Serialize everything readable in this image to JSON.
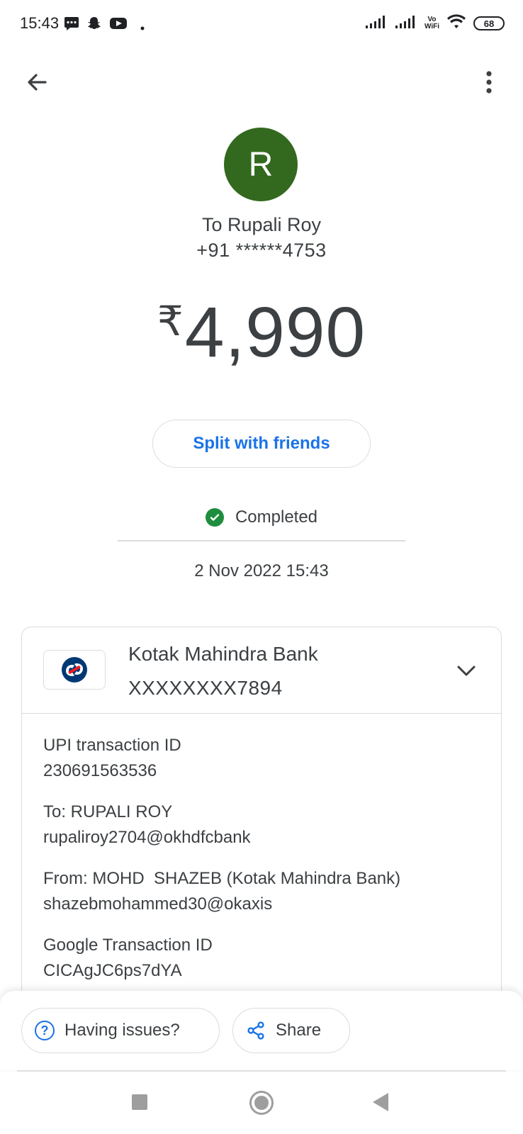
{
  "status_bar": {
    "time": "15:43",
    "battery": "68",
    "vowifi_top": "Vo",
    "vowifi_bottom": "WiFi",
    "left_icons": [
      "message-icon",
      "snapchat-icon",
      "youtube-icon",
      "dot-icon"
    ],
    "right_icons": [
      "signal-icon",
      "signal-icon",
      "vowifi-icon",
      "wifi-icon",
      "battery-icon"
    ]
  },
  "header": {
    "back_icon": "arrow-left-icon",
    "more_icon": "more-vert-icon"
  },
  "recipient": {
    "initial": "R",
    "avatar_color": "#33691e",
    "name_line": "To Rupali Roy",
    "phone": "+91 ******4753"
  },
  "payment": {
    "currency_symbol": "₹",
    "amount": "4,990"
  },
  "split_button": {
    "label": "Split with friends",
    "color": "#1a73e8"
  },
  "transaction_status": {
    "label": "Completed",
    "icon": "check-circle-icon",
    "color": "#1e8e3e"
  },
  "datetime": "2 Nov 2022 15:43",
  "bank_card": {
    "bank_name": "Kotak Mahindra Bank",
    "account_number": "XXXXXXXX7894",
    "logo_icon": "kotak-logo-icon",
    "expand_icon": "chevron-down-icon"
  },
  "details": {
    "upi_label": "UPI transaction ID",
    "upi_value": "230691563536",
    "to_label": "To: RUPALI ROY",
    "to_value": "rupaliroy2704@okhdfcbank",
    "from_label": "From: MOHD  SHAZEB (Kotak Mahindra Bank)",
    "from_value": "shazebmohammed30@okaxis",
    "google_label": "Google Transaction ID",
    "google_value": "CICAgJC6ps7dYA"
  },
  "actions": {
    "issues_label": "Having issues?",
    "share_label": "Share"
  },
  "nav": {
    "icons": [
      "recents-square-icon",
      "home-circle-icon",
      "back-triangle-icon"
    ]
  }
}
